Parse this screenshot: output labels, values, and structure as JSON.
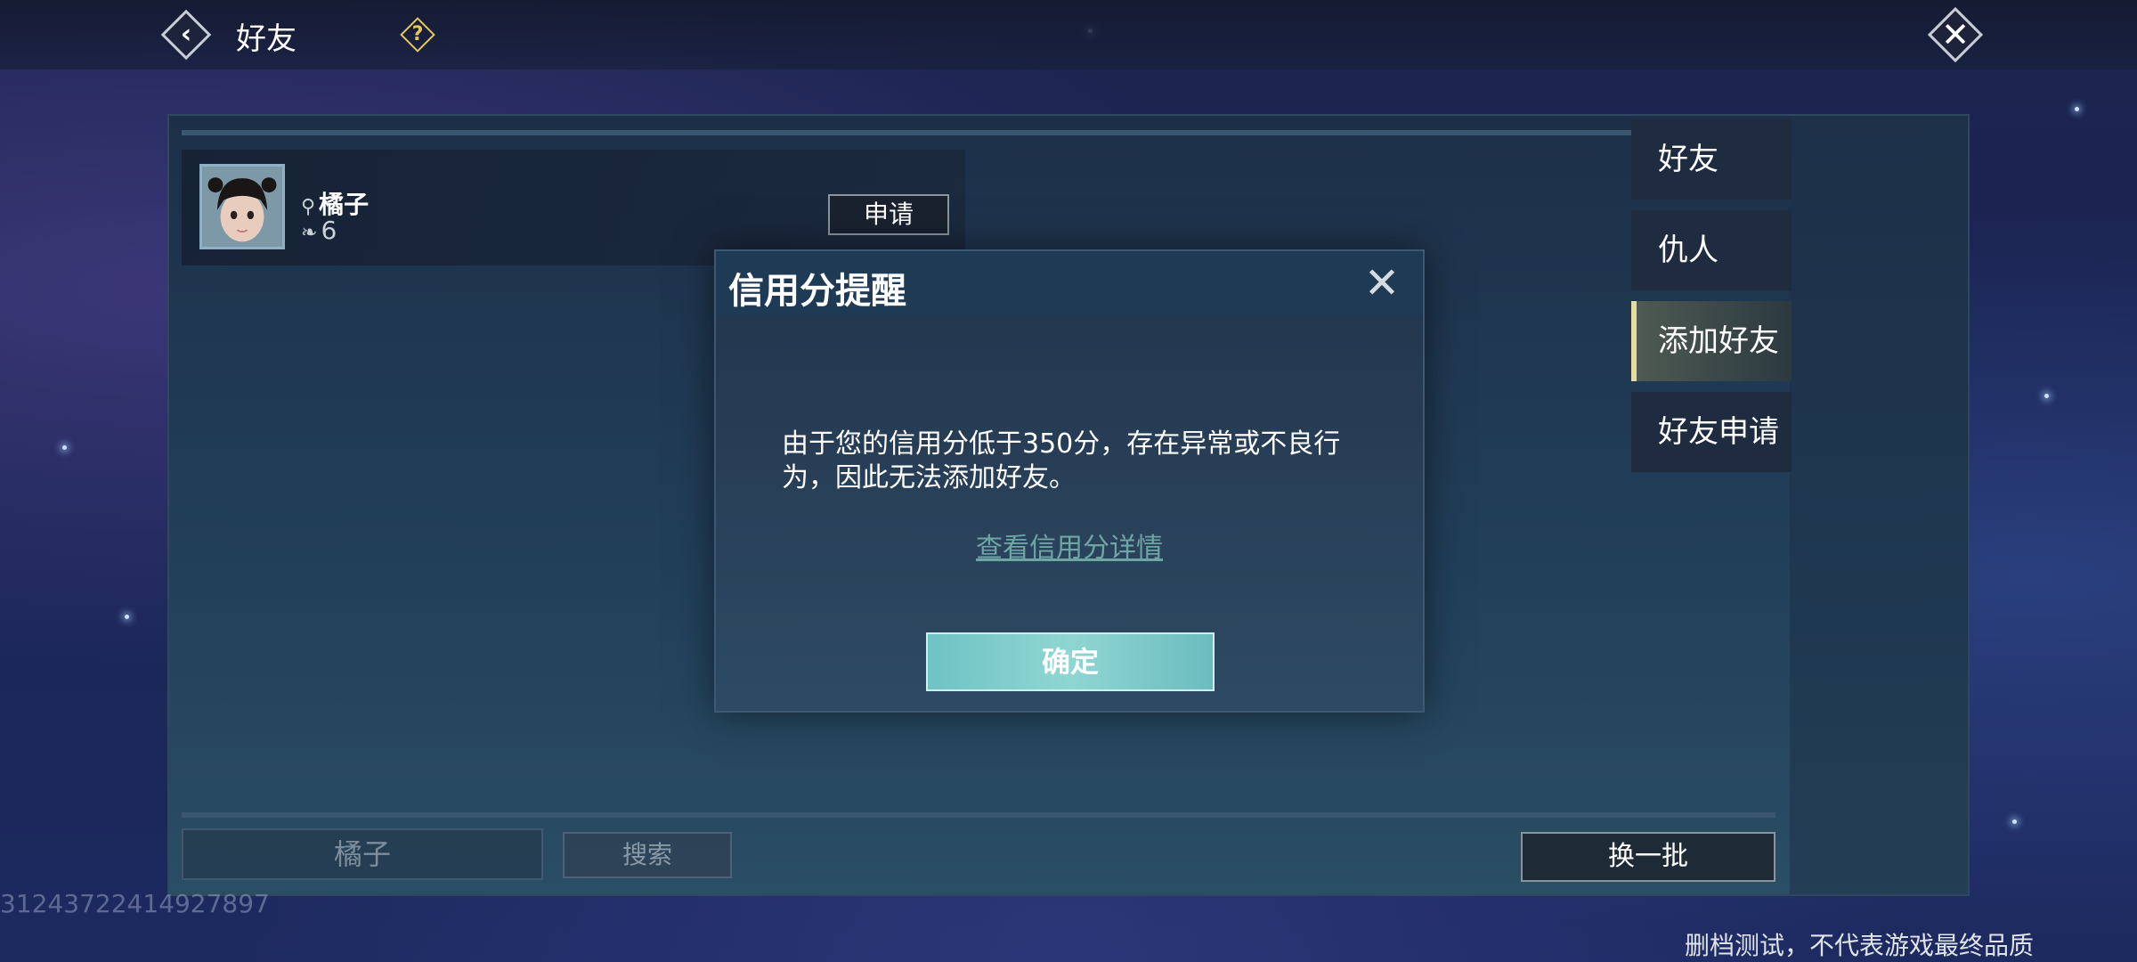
{
  "header": {
    "title": "好友",
    "back_icon": "back-arrow-icon",
    "help_symbol": "?",
    "close_symbol": "✕"
  },
  "friend_card": {
    "name": "橘子",
    "level": "6",
    "apply_label": "申请"
  },
  "search": {
    "input_value": "橘子",
    "button_label": "搜索"
  },
  "refresh_label": "换一批",
  "tabs": [
    {
      "label": "好友",
      "active": false
    },
    {
      "label": "仇人",
      "active": false
    },
    {
      "label": "添加好友",
      "active": true
    },
    {
      "label": "好友申请",
      "active": false
    }
  ],
  "dialog": {
    "title": "信用分提醒",
    "close_symbol": "✕",
    "message": "由于您的信用分低于350分，存在异常或不良行为，因此无法添加好友。",
    "link": "查看信用分详情",
    "confirm": "确定"
  },
  "uid": "31243722414927897",
  "disclaimer": "删档测试，不代表游戏最终品质",
  "colors": {
    "active_tab_accent": "#e5dca0",
    "confirm_button": "#8fd6d2",
    "link": "#6ea6a6",
    "help_icon": "#e6c95a"
  }
}
